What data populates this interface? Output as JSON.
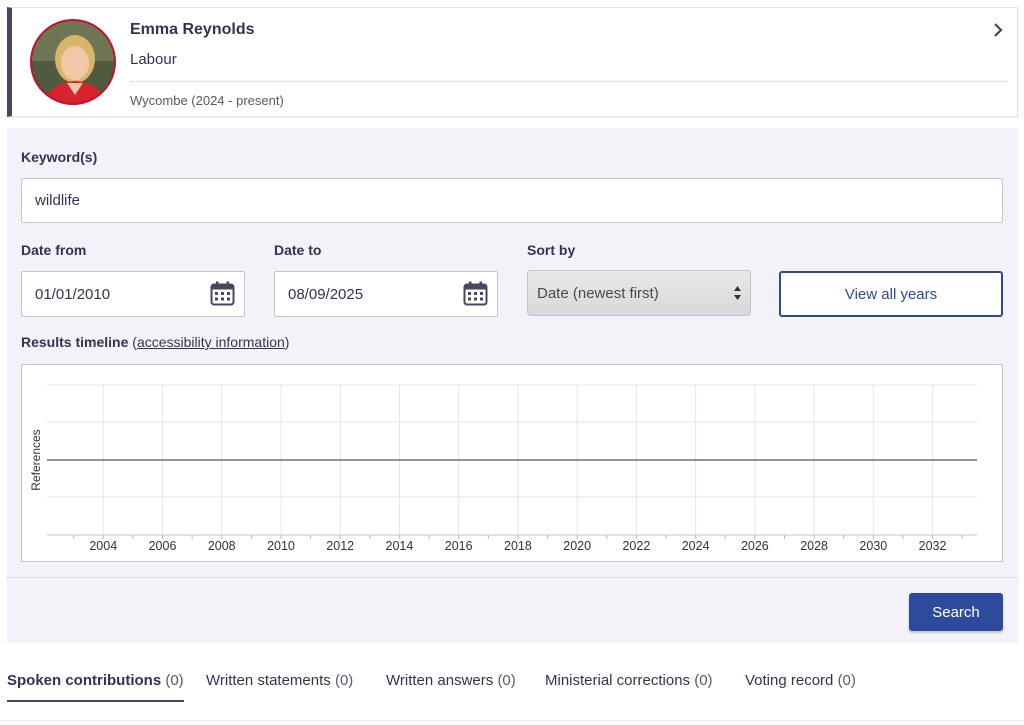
{
  "member": {
    "name": "Emma Reynolds",
    "party": "Labour",
    "constituency": "Wycombe (2024 - present)",
    "party_color": "#c8102e"
  },
  "search": {
    "keyword_label": "Keyword(s)",
    "keyword_value": "wildlife",
    "date_from_label": "Date from",
    "date_from_value": "01/01/2010",
    "date_to_label": "Date to",
    "date_to_value": "08/09/2025",
    "sort_label": "Sort by",
    "sort_value": "Date (newest first)",
    "view_all_years_label": "View all years",
    "search_button_label": "Search"
  },
  "timeline": {
    "title": "Results timeline",
    "accessibility_link": "accessibility information"
  },
  "chart_data": {
    "type": "line",
    "x": [
      2004,
      2006,
      2008,
      2010,
      2012,
      2014,
      2016,
      2018,
      2020,
      2022,
      2024,
      2026,
      2028,
      2030,
      2032
    ],
    "series": [
      {
        "values": [
          0,
          0,
          0,
          0,
          0,
          0,
          0,
          0,
          0,
          0,
          0,
          0,
          0,
          0,
          0
        ]
      }
    ],
    "xlabel": "",
    "ylabel": "References",
    "grid": true
  },
  "tabs": [
    {
      "label": "Spoken contributions",
      "count": "(0)",
      "active": true
    },
    {
      "label": "Written statements",
      "count": "(0)",
      "active": false
    },
    {
      "label": "Written answers",
      "count": "(0)",
      "active": false
    },
    {
      "label": "Ministerial corrections",
      "count": "(0)",
      "active": false
    },
    {
      "label": "Voting record",
      "count": "(0)",
      "active": false
    }
  ],
  "colors": {
    "accent": "#2e4a9c",
    "panel": "#f3f2f8",
    "card_border": "#4b4563"
  }
}
